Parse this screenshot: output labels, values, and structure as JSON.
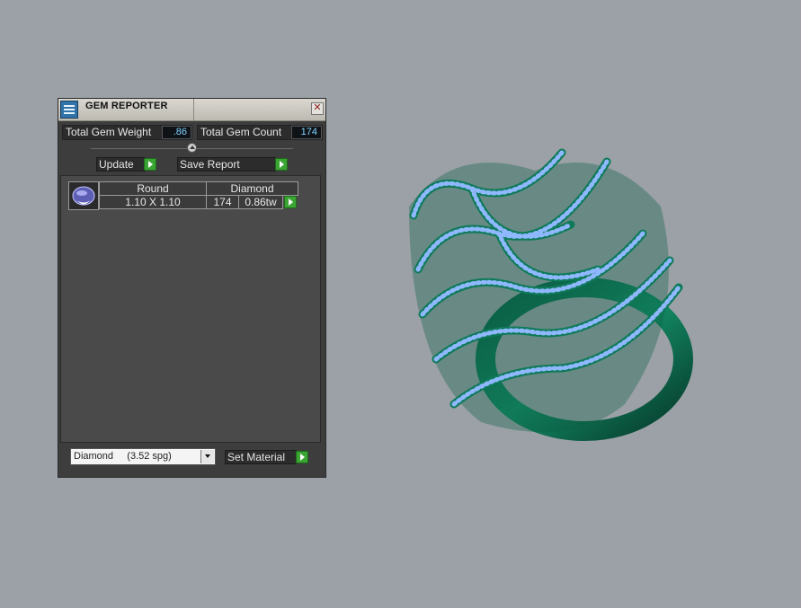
{
  "window": {
    "title": "GEM REPORTER",
    "close_icon": "close-icon"
  },
  "totals": {
    "weight_label": "Total Gem Weight",
    "weight_value": ".86",
    "count_label": "Total Gem Count",
    "count_value": "174"
  },
  "actions": {
    "update_label": "Update",
    "save_label": "Save Report"
  },
  "gem_table": {
    "headers": [
      "Round",
      "Diamond"
    ],
    "rows": [
      {
        "size": "1.10 X 1.10",
        "count": "174",
        "weight": "0.86tw"
      }
    ]
  },
  "material": {
    "selected": "Diamond     (3.52 spg)",
    "set_label": "Set Material"
  },
  "colors": {
    "accent_green": "#3aa533",
    "ring_metal": "#0f7a5a",
    "gem_blue": "#8fb8ff"
  }
}
